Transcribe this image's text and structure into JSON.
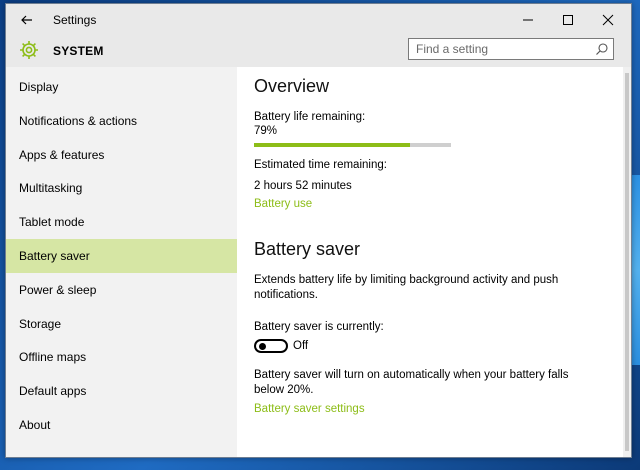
{
  "window": {
    "title": "Settings",
    "section": "SYSTEM",
    "search_placeholder": "Find a setting"
  },
  "icons": {
    "back": "back-arrow-icon",
    "gear": "gear-icon",
    "search": "search-icon",
    "minimize": "minimize-icon",
    "maximize": "maximize-icon",
    "close": "close-icon"
  },
  "colors": {
    "accent": "#8dbd18",
    "active_nav": "#d6e6a4"
  },
  "sidebar": {
    "items": [
      {
        "label": "Display"
      },
      {
        "label": "Notifications & actions"
      },
      {
        "label": "Apps & features"
      },
      {
        "label": "Multitasking"
      },
      {
        "label": "Tablet mode"
      },
      {
        "label": "Battery saver",
        "active": true
      },
      {
        "label": "Power & sleep"
      },
      {
        "label": "Storage"
      },
      {
        "label": "Offline maps"
      },
      {
        "label": "Default apps"
      },
      {
        "label": "About"
      }
    ]
  },
  "overview": {
    "heading": "Overview",
    "battery_label": "Battery life remaining:",
    "battery_value": "79%",
    "battery_fraction": 0.79,
    "estimate_label": "Estimated time remaining:",
    "estimate_value": "2 hours 52 minutes",
    "usage_link": "Battery use"
  },
  "saver": {
    "heading": "Battery saver",
    "description_line1": "Extends battery life by limiting background activity and push",
    "description_line2": "notifications.",
    "status_label": "Battery saver is currently:",
    "toggle_state": "Off",
    "auto_line1": "Battery saver will turn on automatically when your battery falls",
    "auto_line2": "below 20%.",
    "settings_link": "Battery saver settings"
  }
}
